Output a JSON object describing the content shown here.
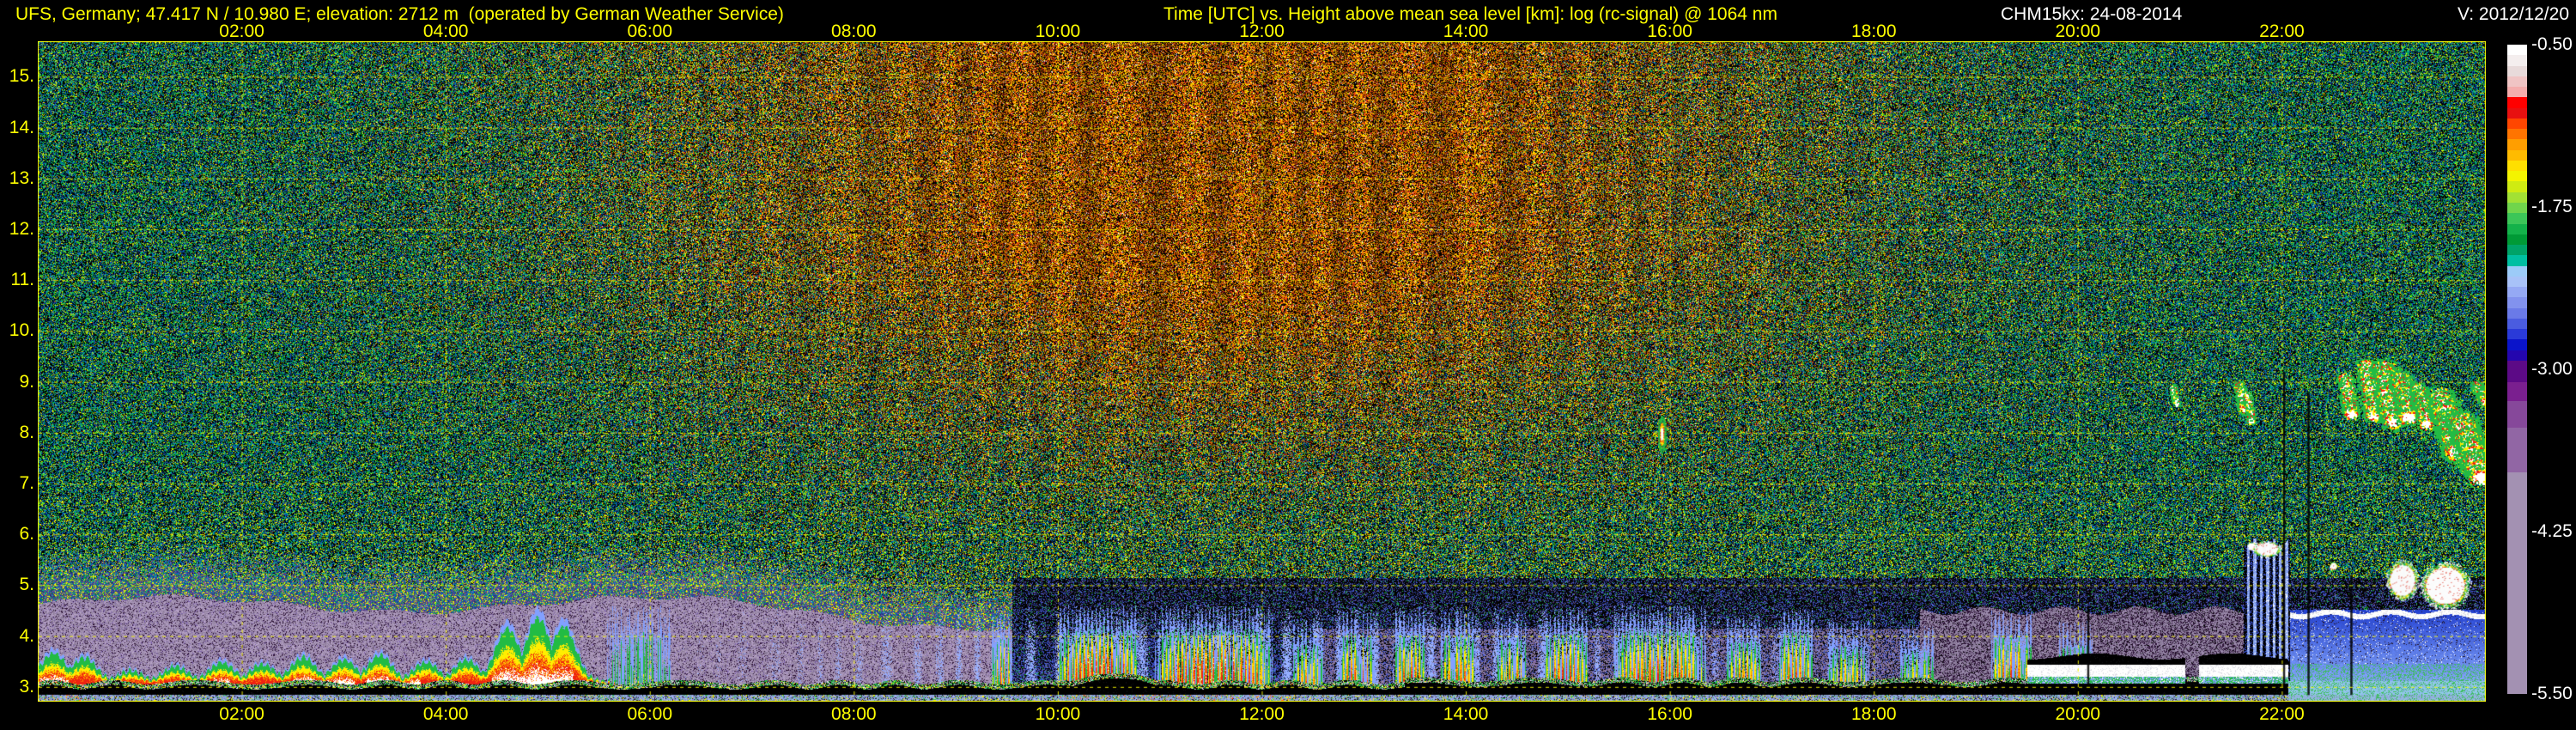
{
  "header": {
    "station": "UFS, Germany; 47.417 N / 10.980 E; elevation: 2712 m  (operated by German Weather Service)",
    "title": "Time [UTC] vs. Height above mean sea level [km]: log (rc-signal) @ 1064 nm",
    "instrument": "CHM15kx: 24-08-2014",
    "version": "V: 2012/12/20"
  },
  "axes": {
    "x_ticks": [
      {
        "hour": 2,
        "label": "02:00"
      },
      {
        "hour": 4,
        "label": "04:00"
      },
      {
        "hour": 6,
        "label": "06:00"
      },
      {
        "hour": 8,
        "label": "08:00"
      },
      {
        "hour": 10,
        "label": "10:00"
      },
      {
        "hour": 12,
        "label": "12:00"
      },
      {
        "hour": 14,
        "label": "14:00"
      },
      {
        "hour": 16,
        "label": "16:00"
      },
      {
        "hour": 18,
        "label": "18:00"
      },
      {
        "hour": 20,
        "label": "20:00"
      },
      {
        "hour": 22,
        "label": "22:00"
      }
    ],
    "y_ticks": [
      {
        "km": 15,
        "label": "15."
      },
      {
        "km": 14,
        "label": "14."
      },
      {
        "km": 13,
        "label": "13."
      },
      {
        "km": 12,
        "label": "12."
      },
      {
        "km": 11,
        "label": "11."
      },
      {
        "km": 10,
        "label": "10."
      },
      {
        "km": 9,
        "label": "9."
      },
      {
        "km": 8,
        "label": "8."
      },
      {
        "km": 7,
        "label": "7."
      },
      {
        "km": 6,
        "label": "6."
      },
      {
        "km": 5,
        "label": "5."
      },
      {
        "km": 4,
        "label": "4."
      },
      {
        "km": 3,
        "label": "3."
      }
    ]
  },
  "colorbar": {
    "ticks": [
      {
        "label": "-0.50",
        "frac": 0.0
      },
      {
        "label": "-1.75",
        "frac": 0.25
      },
      {
        "label": "-3.00",
        "frac": 0.5
      },
      {
        "label": "-4.25",
        "frac": 0.75
      },
      {
        "label": "-5.50",
        "frac": 1.0
      }
    ],
    "upper_colors": [
      "#ffffff",
      "#f4eeee",
      "#e8dada",
      "#f0c4c4",
      "#f4acac",
      "#ff0000",
      "#e81010",
      "#ff4600",
      "#ff7400",
      "#ff9e00",
      "#ffbb00",
      "#ffdf00",
      "#f4f400",
      "#cfeb12",
      "#a2e134",
      "#70d54c",
      "#3cc658",
      "#14b24a",
      "#009a36",
      "#00a368",
      "#00bfa2",
      "#9ccbf8",
      "#a8c2f8",
      "#95a9f4",
      "#8292ee",
      "#6a7ae8",
      "#4a5ce0",
      "#2a3ad8",
      "#0a14ca",
      "#2406ae"
    ],
    "lower_blocks": [
      [
        "#5c0a86",
        25
      ],
      [
        "#7a1f8f",
        22
      ],
      [
        "#86489a",
        31
      ],
      [
        "#9166a4",
        52
      ],
      [
        "#a391b2",
        258
      ]
    ]
  },
  "chart_data": {
    "type": "heatmap",
    "title": "log (rc-signal) @ 1064 nm",
    "x_label": "Time [UTC]",
    "y_label": "Height above mean sea level [km]",
    "x_range_hours": [
      0,
      24
    ],
    "y_range_km": [
      2.71,
      15.7
    ],
    "colorscale_range": [
      -0.5,
      -5.5
    ],
    "grid": "dashed yellow, 2 h x 1 km",
    "accent_color": "#ffff00",
    "noise": {
      "day": [
        "#cc2222",
        "#ee5500",
        "#ffaa00",
        "#ffee00",
        "#ffffff",
        "#994400",
        "#cc7700"
      ],
      "night_green": [
        "#00aa44",
        "#11cc55",
        "#22cc22",
        "#99cc00",
        "#117733"
      ],
      "night_blue": [
        "#0055aa",
        "#0077cc",
        "#2244aa",
        "#00aaaa",
        "#113377"
      ]
    },
    "features": {
      "boundary_layer_clouds": {
        "t_range": [
          0.0,
          5.65
        ],
        "base_km": 3.05,
        "bumps": [
          [
            0.15,
            3.75
          ],
          [
            0.45,
            3.65
          ],
          [
            0.9,
            3.35
          ],
          [
            1.35,
            3.45
          ],
          [
            1.8,
            3.55
          ],
          [
            2.2,
            3.5
          ],
          [
            2.6,
            3.65
          ],
          [
            3.0,
            3.6
          ],
          [
            3.35,
            3.7
          ],
          [
            3.8,
            3.55
          ],
          [
            4.2,
            3.6
          ],
          [
            4.6,
            4.3
          ],
          [
            4.9,
            4.55
          ],
          [
            5.15,
            4.35
          ]
        ],
        "white_windows": [
          [
            0.0,
            0.3
          ],
          [
            1.72,
            1.88
          ],
          [
            2.5,
            3.1
          ],
          [
            3.2,
            3.75
          ],
          [
            4.45,
            5.25
          ]
        ]
      },
      "virga_showers": {
        "clusters": [
          [
            9.35,
            9.55,
            4.2,
            0.75
          ],
          [
            10.0,
            10.8,
            4.35,
            1.0
          ],
          [
            10.95,
            12.1,
            4.35,
            1.0
          ],
          [
            12.3,
            12.6,
            4.1,
            0.6
          ],
          [
            12.75,
            13.1,
            4.25,
            0.75
          ],
          [
            13.3,
            13.6,
            4.3,
            0.8
          ],
          [
            13.75,
            14.1,
            4.25,
            0.75
          ],
          [
            14.3,
            14.6,
            4.2,
            0.7
          ],
          [
            14.75,
            15.2,
            4.3,
            0.8
          ],
          [
            15.45,
            16.35,
            4.35,
            0.85
          ],
          [
            16.55,
            16.9,
            4.15,
            0.65
          ],
          [
            17.05,
            17.4,
            4.3,
            0.75
          ],
          [
            17.55,
            17.95,
            4.05,
            0.55
          ],
          [
            18.25,
            18.6,
            3.95,
            0.5
          ],
          [
            19.15,
            19.55,
            4.25,
            0.85
          ],
          [
            19.8,
            20.15,
            4.05,
            0.6
          ]
        ],
        "green_cluster": [
          5.55,
          6.25,
          4.35,
          0.6
        ]
      },
      "mauve_haze_morning": {
        "t_range": [
          0,
          9.55
        ],
        "top_km": 4.6
      },
      "purple_haze_afternoon": {
        "t_range": [
          12.5,
          18.45
        ],
        "top_km": 4.15
      },
      "mauve_band_evening": {
        "t_range": [
          18.45,
          22.06
        ],
        "top_km": 4.5
      },
      "blue_streaks": {
        "t_range": [
          6.3,
          18.45
        ],
        "top_km": 4.55
      },
      "tall_columns": {
        "t_range": [
          21.62,
          22.08
        ],
        "top_km": 5.85
      },
      "bright_blue_evening": {
        "t_range": [
          22.06,
          24
        ],
        "top_km": 4.52,
        "white_line_km": 4.43
      },
      "surface": {
        "black_top_km": 3.05,
        "raised_band": [
          19.5,
          22.06,
          3.6
        ],
        "mound": [
          10.15,
          10.95,
          0.22
        ]
      },
      "upper_cloud_streaks": [
        [
          20.93,
          8.9,
          20.97,
          8.55,
          0.05
        ],
        [
          21.58,
          8.95,
          21.63,
          8.45,
          0.08
        ],
        [
          21.66,
          8.8,
          21.7,
          8.2,
          0.06
        ],
        [
          22.62,
          9.1,
          22.68,
          8.35,
          0.11
        ],
        [
          22.82,
          9.35,
          22.9,
          8.3,
          0.13
        ],
        [
          23.0,
          9.3,
          23.1,
          8.2,
          0.18
        ],
        [
          23.17,
          9.1,
          23.24,
          8.3,
          0.15
        ],
        [
          23.34,
          8.9,
          23.42,
          8.15,
          0.12
        ],
        [
          23.55,
          8.75,
          23.73,
          7.6,
          0.2
        ],
        [
          23.76,
          8.25,
          23.96,
          7.1,
          0.22
        ],
        [
          23.9,
          8.95,
          24.0,
          8.6,
          0.09
        ]
      ],
      "low_cloud_blobs": [
        [
          23.18,
          5.1,
          0.17,
          0.42
        ],
        [
          23.6,
          5.0,
          0.26,
          0.5
        ],
        [
          21.85,
          5.72,
          0.15,
          0.17
        ],
        [
          21.7,
          5.78,
          0.05,
          0.08
        ],
        [
          22.5,
          5.38,
          0.04,
          0.09
        ]
      ],
      "rainbow_speck": {
        "t": 15.92,
        "km_range": [
          7.6,
          8.35
        ]
      },
      "data_gaps": [
        [
          20.1,
          4.6
        ],
        [
          22.02,
          9.2
        ],
        [
          22.26,
          8.8
        ],
        [
          22.68,
          5.2
        ]
      ]
    }
  }
}
